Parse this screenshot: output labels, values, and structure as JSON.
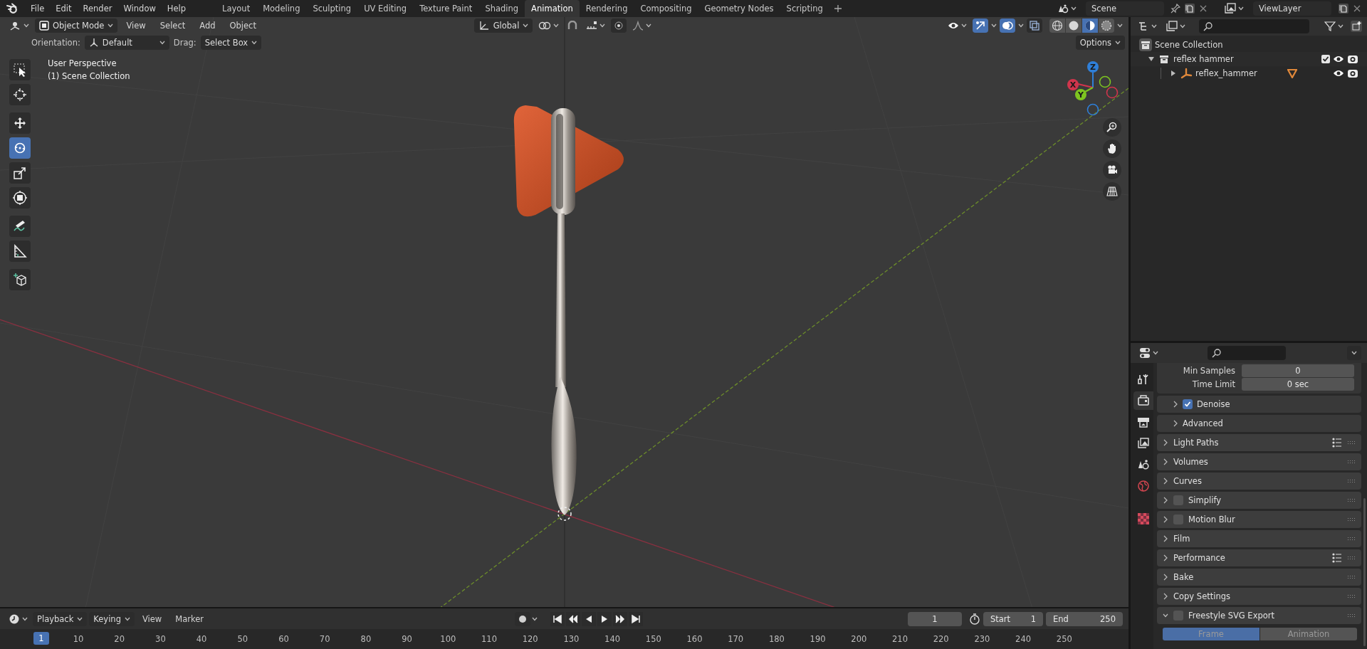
{
  "top_bar": {
    "menus": [
      "File",
      "Edit",
      "Render",
      "Window",
      "Help"
    ],
    "workspaces": [
      {
        "label": "Layout",
        "selected": false
      },
      {
        "label": "Modeling",
        "selected": false
      },
      {
        "label": "Sculpting",
        "selected": false
      },
      {
        "label": "UV Editing",
        "selected": false
      },
      {
        "label": "Texture Paint",
        "selected": false
      },
      {
        "label": "Shading",
        "selected": false
      },
      {
        "label": "Animation",
        "selected": true
      },
      {
        "label": "Rendering",
        "selected": false
      },
      {
        "label": "Compositing",
        "selected": false
      },
      {
        "label": "Geometry Nodes",
        "selected": false
      },
      {
        "label": "Scripting",
        "selected": false
      }
    ],
    "scene": "Scene",
    "view_layer": "ViewLayer"
  },
  "viewport": {
    "header": {
      "mode": "Object Mode",
      "menus": [
        "View",
        "Select",
        "Add",
        "Object"
      ],
      "transform": "Global",
      "toggles": [
        {
          "kind": "gizmo",
          "on": true
        },
        {
          "kind": "overlay",
          "on": true
        },
        {
          "kind": "xray",
          "on": false
        }
      ],
      "shading": [
        {
          "kind": "wireframe",
          "selected": false
        },
        {
          "kind": "solid",
          "selected": false
        },
        {
          "kind": "material",
          "selected": true
        },
        {
          "kind": "rendered",
          "selected": false
        }
      ]
    },
    "tool_settings": {
      "orientation_label": "Orientation:",
      "orientation": "Default",
      "drag_label": "Drag:",
      "drag": "Select Box",
      "options": "Options"
    },
    "tools": [
      {
        "kind": "select",
        "selected": false
      },
      {
        "kind": "cursor",
        "selected": false
      },
      {
        "kind": "move",
        "selected": false
      },
      {
        "kind": "rotate",
        "selected": true
      },
      {
        "kind": "scale",
        "selected": false
      },
      {
        "kind": "transform",
        "selected": false
      },
      {
        "kind": "annotate",
        "selected": false
      },
      {
        "kind": "measure",
        "selected": false
      },
      {
        "kind": "add_cube",
        "selected": false
      }
    ],
    "view_info": [
      "User Perspective",
      "(1) Scene Collection"
    ],
    "gizmo_axes": [
      {
        "label": "Z",
        "color": "#2f7fd8"
      },
      {
        "label": "X",
        "color": "#d0354c"
      },
      {
        "label": "Y",
        "color": "#7ec520"
      }
    ]
  },
  "outliner": {
    "items": [
      {
        "label": "Scene Collection",
        "kind": "scene",
        "children": [
          {
            "label": "reflex hammer",
            "kind": "collection",
            "expanded": true,
            "checked": true,
            "children": [
              {
                "label": "reflex_hammer",
                "kind": "empty",
                "expanded": false,
                "mesh_data": true
              }
            ]
          }
        ]
      }
    ]
  },
  "properties": {
    "tabs": [
      {
        "kind": "tool",
        "selected": false
      },
      {
        "kind": "render",
        "selected": true
      },
      {
        "kind": "output",
        "selected": false
      },
      {
        "kind": "view_layer",
        "selected": false
      },
      {
        "kind": "scene",
        "selected": false
      },
      {
        "kind": "world",
        "selected": false
      },
      {
        "kind": "texture",
        "selected": false
      }
    ],
    "fields": [
      {
        "label": "Min Samples",
        "value": "0"
      },
      {
        "label": "Time Limit",
        "value": "0 sec"
      }
    ],
    "subpanels": [
      {
        "label": "Denoise",
        "expanded": false,
        "checked": true
      },
      {
        "label": "Advanced",
        "expanded": false
      }
    ],
    "panels": [
      {
        "label": "Light Paths",
        "expanded": false,
        "presets": true
      },
      {
        "label": "Volumes",
        "expanded": false
      },
      {
        "label": "Curves",
        "expanded": false
      },
      {
        "label": "Simplify",
        "expanded": false,
        "checked": false
      },
      {
        "label": "Motion Blur",
        "expanded": false,
        "checked": false
      },
      {
        "label": "Film",
        "expanded": false
      },
      {
        "label": "Performance",
        "expanded": false,
        "presets": true
      },
      {
        "label": "Bake",
        "expanded": false
      },
      {
        "label": "Copy Settings",
        "expanded": false
      },
      {
        "label": "Freestyle SVG Export",
        "expanded": true,
        "checked": false
      }
    ],
    "export_modes": [
      {
        "label": "Frame",
        "selected": true
      },
      {
        "label": "Animation",
        "selected": false
      }
    ]
  },
  "timeline": {
    "menus": [
      {
        "label": "Playback",
        "dropdown": true
      },
      {
        "label": "Keying",
        "dropdown": true
      },
      {
        "label": "View",
        "dropdown": false
      },
      {
        "label": "Marker",
        "dropdown": false
      }
    ],
    "auto_keying": false,
    "current_frame": "1",
    "start_label": "Start",
    "start": "1",
    "end_label": "End",
    "end": "250",
    "playhead": "1",
    "ruler": [
      "10",
      "20",
      "30",
      "40",
      "50",
      "60",
      "70",
      "80",
      "90",
      "100",
      "110",
      "120",
      "130",
      "140",
      "150",
      "160",
      "170",
      "180",
      "190",
      "200",
      "210",
      "220",
      "230",
      "240",
      "250"
    ]
  }
}
